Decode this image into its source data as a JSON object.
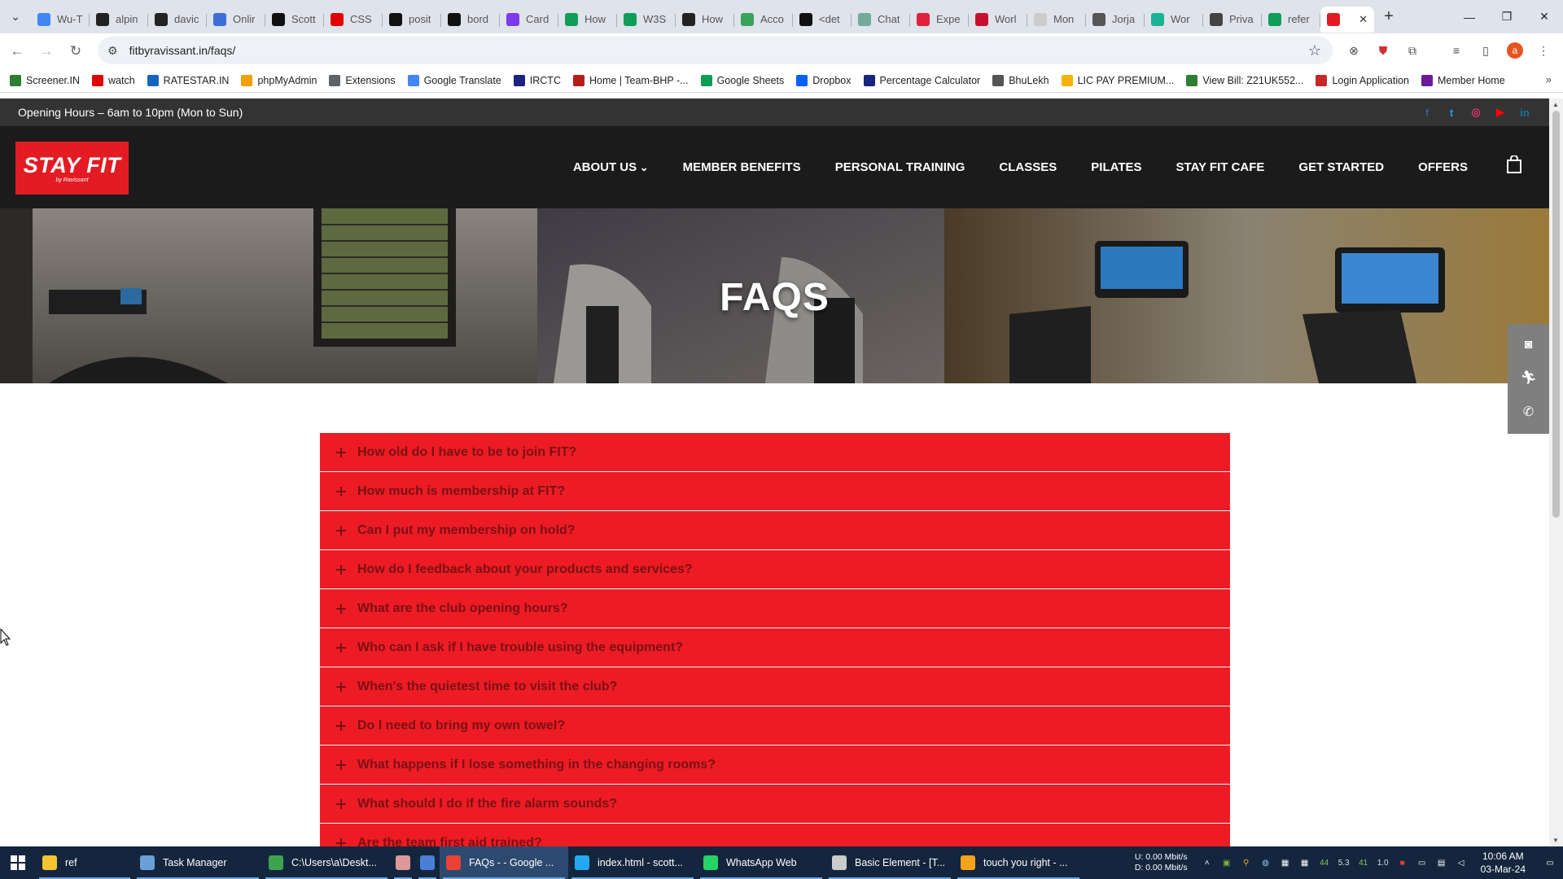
{
  "browser": {
    "tabs": [
      {
        "title": "Wu-T",
        "icon": "google-icon",
        "color": "#4285f4"
      },
      {
        "title": "alpin",
        "icon": "github-icon",
        "color": "#222222"
      },
      {
        "title": "davic",
        "icon": "github-icon",
        "color": "#222222"
      },
      {
        "title": "Onlir",
        "icon": "circle-a-icon",
        "color": "#3b6fd6"
      },
      {
        "title": "Scott",
        "icon": "s-icon",
        "color": "#111111"
      },
      {
        "title": "CSS",
        "icon": "youtube-icon",
        "color": "#e00000"
      },
      {
        "title": "posit",
        "icon": "medium-icon",
        "color": "#111111"
      },
      {
        "title": "bord",
        "icon": "medium-icon",
        "color": "#111111"
      },
      {
        "title": "Card",
        "icon": "bootstrap-icon",
        "color": "#7c3aed"
      },
      {
        "title": "How",
        "icon": "w-icon",
        "color": "#0f9d58"
      },
      {
        "title": "W3S",
        "icon": "w-icon",
        "color": "#0f9d58"
      },
      {
        "title": "How",
        "icon": "a-icon",
        "color": "#222222"
      },
      {
        "title": "Acco",
        "icon": "glasses-icon",
        "color": "#3aa35a"
      },
      {
        "title": "<det",
        "icon": "medium-icon",
        "color": "#111111"
      },
      {
        "title": "Chat",
        "icon": "chatgpt-icon",
        "color": "#74aa9c"
      },
      {
        "title": "Expe",
        "icon": "arrow-icon",
        "color": "#e0223a"
      },
      {
        "title": "Worl",
        "icon": "flag-icon",
        "color": "#c8102e"
      },
      {
        "title": "Mon",
        "icon": "cloud-icon",
        "color": "#cccccc"
      },
      {
        "title": "Jorja",
        "icon": "feather-icon",
        "color": "#555555"
      },
      {
        "title": "Wor",
        "icon": "v-icon",
        "color": "#1ab394"
      },
      {
        "title": "Priva",
        "icon": "wiki-icon",
        "color": "#444444"
      },
      {
        "title": "refer",
        "icon": "sheets-icon",
        "color": "#0f9d58"
      }
    ],
    "active_tab_color": "#e31b23",
    "url": "fitbyravissant.in/faqs/",
    "avatar_letter": "a",
    "bookmarks": [
      {
        "label": "Screener.IN",
        "color": "#2e7d32"
      },
      {
        "label": "watch",
        "color": "#e00000"
      },
      {
        "label": "RATESTAR.IN",
        "color": "#1565c0"
      },
      {
        "label": "phpMyAdmin",
        "color": "#f0a000"
      },
      {
        "label": "Extensions",
        "color": "#5f6368"
      },
      {
        "label": "Google Translate",
        "color": "#4285f4"
      },
      {
        "label": "IRCTC",
        "color": "#1a237e"
      },
      {
        "label": "Home | Team-BHP -...",
        "color": "#b71c1c"
      },
      {
        "label": "Google Sheets",
        "color": "#0f9d58"
      },
      {
        "label": "Dropbox",
        "color": "#0061ff"
      },
      {
        "label": "Percentage Calculator",
        "color": "#1a237e"
      },
      {
        "label": "BhuLekh",
        "color": "#555555"
      },
      {
        "label": "LIC PAY PREMIUM...",
        "color": "#f6b400"
      },
      {
        "label": "View Bill: Z21UK552...",
        "color": "#2e7d32"
      },
      {
        "label": "Login Application",
        "color": "#c62828"
      },
      {
        "label": "Member Home",
        "color": "#6a1b9a"
      }
    ]
  },
  "site": {
    "opening_hours": "Opening Hours – 6am to 10pm (Mon to Sun)",
    "social": [
      {
        "name": "facebook-icon",
        "glyph": "f",
        "color": "#3b5998"
      },
      {
        "name": "twitter-icon",
        "glyph": "t",
        "color": "#1da1f2"
      },
      {
        "name": "instagram-icon",
        "glyph": "◎",
        "color": "#e1306c"
      },
      {
        "name": "youtube-icon",
        "glyph": "▶",
        "color": "#ff0000"
      },
      {
        "name": "linkedin-icon",
        "glyph": "in",
        "color": "#0e76a8"
      }
    ],
    "logo": {
      "main": "STAY FIT",
      "sub": "by Ravissant"
    },
    "menu": [
      "ABOUT US",
      "MEMBER BENEFITS",
      "PERSONAL TRAINING",
      "CLASSES",
      "PILATES",
      "STAY FIT CAFE",
      "GET STARTED",
      "OFFERS"
    ],
    "hero_title": "FAQS",
    "brand_red": "#ed1c24",
    "faqs": [
      "How old do I have to be to join FIT?",
      "How much is membership at FIT?",
      "Can I put my membership on hold?",
      "How do I feedback about your products and services?",
      "What are the club opening hours?",
      "Who can I ask if I have trouble using the equipment?",
      "When's the quietest time to visit the club?",
      "Do I need to bring my own towel?",
      "What happens if I lose something in the changing rooms?",
      "What should I do if the fire alarm sounds?",
      "Are the team first aid trained?"
    ]
  },
  "taskbar": {
    "items": [
      {
        "label": "ref",
        "color": "#f4c430",
        "active": false
      },
      {
        "label": "Task Manager",
        "color": "#6aa0d8",
        "active": false
      },
      {
        "label": "C:\\Users\\a\\Deskt...",
        "color": "#3fa34d",
        "active": false
      },
      {
        "label": "",
        "color": "#d99",
        "active": false
      },
      {
        "label": "",
        "color": "#4a7fd6",
        "active": false
      },
      {
        "label": "FAQs - - Google ...",
        "color": "#ea4335",
        "active": true
      },
      {
        "label": "index.html - scott...",
        "color": "#23a9f2",
        "active": false
      },
      {
        "label": "WhatsApp Web",
        "color": "#25d366",
        "active": false
      },
      {
        "label": "Basic Element - [T...",
        "color": "#cccccc",
        "active": false
      },
      {
        "label": "touch you right - ...",
        "color": "#f7a21b",
        "active": false
      }
    ],
    "net_up": "U:  0.00 Mbit/s",
    "net_down": "D:  0.00 Mbit/s",
    "tray_numbers": [
      "44",
      "5.3",
      "41",
      "1.0"
    ],
    "time": "10:06 AM",
    "date": "03-Mar-24"
  }
}
